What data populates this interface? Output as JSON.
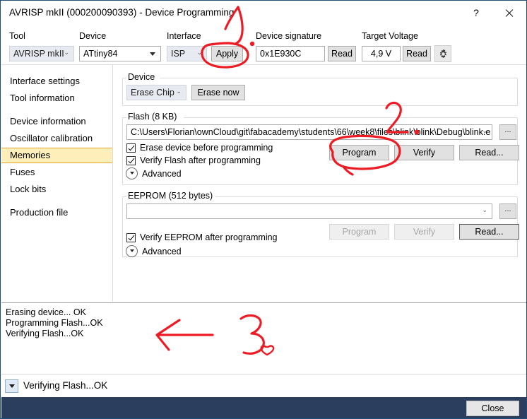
{
  "window": {
    "title": "AVRISP mkII (000200090393) - Device Programming",
    "help_icon": "?",
    "close_icon": "close-icon"
  },
  "toolbar": {
    "tool_label": "Tool",
    "tool_value": "AVRISP mkII",
    "device_label": "Device",
    "device_value": "ATtiny84",
    "interface_label": "Interface",
    "interface_value": "ISP",
    "apply_label": "Apply",
    "device_signature_label": "Device signature",
    "device_signature_value": "0x1E930C",
    "signature_read_label": "Read",
    "target_voltage_label": "Target Voltage",
    "target_voltage_value": "4,9 V",
    "voltage_read_label": "Read",
    "settings_icon": "gear-icon"
  },
  "sidebar": {
    "items": [
      {
        "label": "Interface settings",
        "selected": false
      },
      {
        "label": "Tool information",
        "selected": false
      },
      {
        "label": "Device information",
        "selected": false
      },
      {
        "label": "Oscillator calibration",
        "selected": false
      },
      {
        "label": "Memories",
        "selected": true
      },
      {
        "label": "Fuses",
        "selected": false
      },
      {
        "label": "Lock bits",
        "selected": false
      },
      {
        "label": "Production file",
        "selected": false
      }
    ]
  },
  "device_group": {
    "title": "Device",
    "erase_mode_value": "Erase Chip",
    "erase_now_label": "Erase now"
  },
  "flash_group": {
    "title": "Flash (8 KB)",
    "path_value": "C:\\Users\\Florian\\ownCloud\\git\\fabacademy\\students\\66\\week8\\files\\blink\\blink\\Debug\\blink.e",
    "browse_label": "...",
    "checkbox_erase_label": "Erase device before programming",
    "checkbox_erase_checked": true,
    "checkbox_verify_label": "Verify Flash after programming",
    "checkbox_verify_checked": true,
    "advanced_label": "Advanced",
    "program_label": "Program",
    "verify_label": "Verify",
    "read_label": "Read..."
  },
  "eeprom_group": {
    "title": "EEPROM (512 bytes)",
    "path_value": "",
    "browse_label": "...",
    "checkbox_verify_label": "Verify EEPROM after programming",
    "checkbox_verify_checked": true,
    "advanced_label": "Advanced",
    "program_label": "Program",
    "verify_label": "Verify",
    "read_label": "Read..."
  },
  "log": {
    "lines": [
      "Erasing device... OK",
      "Programming Flash...OK",
      "Verifying Flash...OK"
    ]
  },
  "statusbar": {
    "expander_icon": "chevron-down-icon",
    "text": "Verifying Flash...OK"
  },
  "footer": {
    "close_label": "Close"
  },
  "annotations": {
    "ink_color": "#ed1c24",
    "marks": [
      {
        "name": "step-1-numeral",
        "note": "handwritten 1 above Apply button"
      },
      {
        "name": "apply-circle",
        "note": "red ellipse around Apply button"
      },
      {
        "name": "step-2-numeral",
        "note": "handwritten 2 above Program button"
      },
      {
        "name": "program-circle",
        "note": "red ellipse around Program button"
      },
      {
        "name": "step-3-numeral",
        "note": "handwritten 3 in log area"
      },
      {
        "name": "log-arrow",
        "note": "red left-pointing arrow at log output"
      },
      {
        "name": "heart-mark",
        "note": "small red heart next to 3"
      }
    ]
  }
}
